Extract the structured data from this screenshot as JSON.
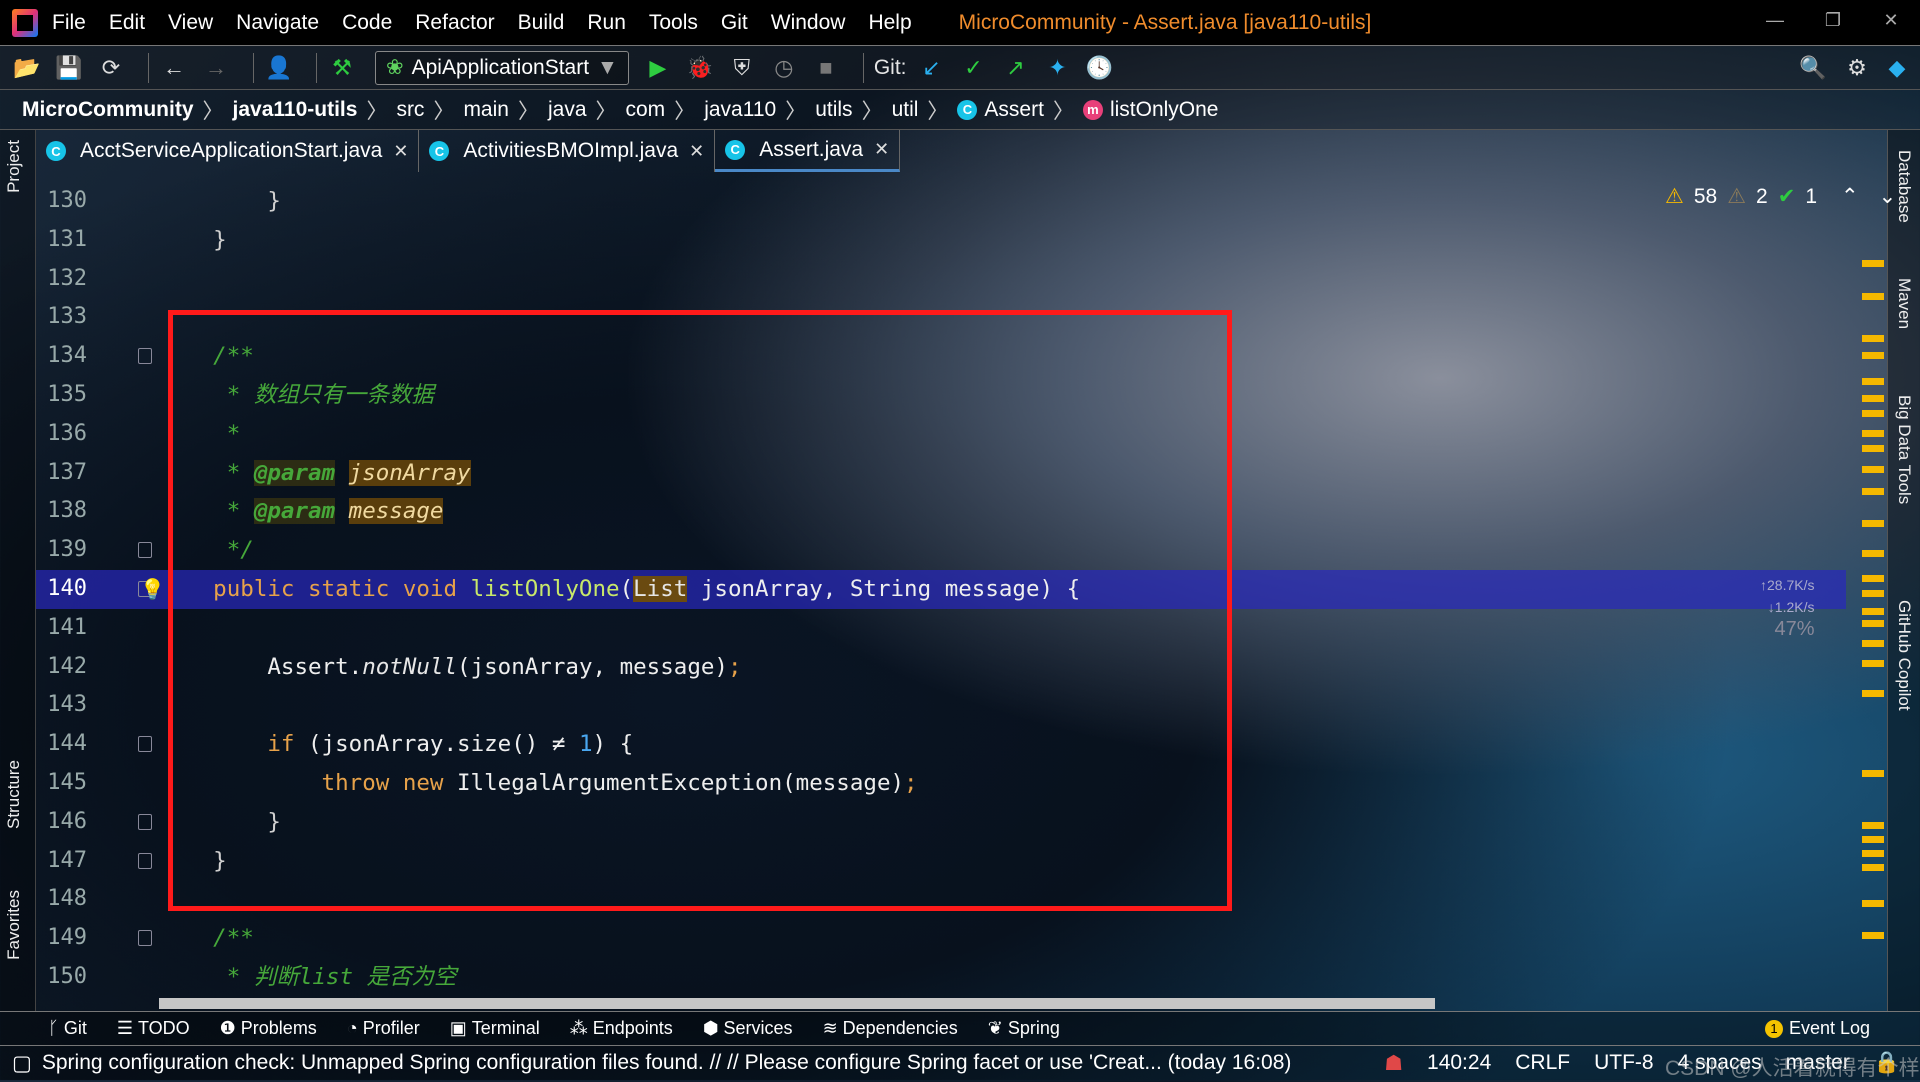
{
  "window": {
    "title": "MicroCommunity - Assert.java [java110-utils]",
    "controls": [
      "—",
      "❐",
      "✕"
    ]
  },
  "menu": [
    "File",
    "Edit",
    "View",
    "Navigate",
    "Code",
    "Refactor",
    "Build",
    "Run",
    "Tools",
    "Git",
    "Window",
    "Help"
  ],
  "toolbar": {
    "run_config": "ApiApplicationStart",
    "git_label": "Git:"
  },
  "breadcrumb": [
    "MicroCommunity",
    "java110-utils",
    "src",
    "main",
    "java",
    "com",
    "java110",
    "utils",
    "util",
    "Assert",
    "listOnlyOne"
  ],
  "tabs": [
    {
      "label": "AcctServiceApplicationStart.java"
    },
    {
      "label": "ActivitiesBMOImpl.java"
    },
    {
      "label": "Assert.java",
      "active": true
    }
  ],
  "left_tools": {
    "project": "Project",
    "structure": "Structure",
    "favorites": "Favorites"
  },
  "right_tools": {
    "database": "Database",
    "maven": "Maven",
    "bigdata": "Big Data Tools",
    "copilot": "GitHub Copilot"
  },
  "inspections": {
    "warnings": "58",
    "weak_warnings": "2",
    "typos": "1"
  },
  "network": {
    "up": "↑28.7K/s",
    "down": "↓1.2K/s",
    "percent": "47%"
  },
  "editor": {
    "current_line": 140,
    "lines": [
      {
        "n": 130,
        "tokens": [
          {
            "t": "        }",
            "c": "br"
          }
        ]
      },
      {
        "n": 131,
        "tokens": [
          {
            "t": "    }",
            "c": "br"
          }
        ]
      },
      {
        "n": 132,
        "tokens": []
      },
      {
        "n": 133,
        "tokens": []
      },
      {
        "n": 134,
        "fold": true,
        "tokens": [
          {
            "t": "    /**",
            "c": "cm"
          }
        ]
      },
      {
        "n": 135,
        "tokens": [
          {
            "t": "     * 数组只有一条数据",
            "c": "cm"
          }
        ]
      },
      {
        "n": 136,
        "tokens": [
          {
            "t": "     *",
            "c": "cm"
          }
        ]
      },
      {
        "n": 137,
        "tokens": [
          {
            "t": "     * ",
            "c": "cm"
          },
          {
            "t": "@param",
            "c": "tag"
          },
          {
            "t": " ",
            "c": "cm"
          },
          {
            "t": "jsonArray",
            "c": "pv"
          }
        ]
      },
      {
        "n": 138,
        "tokens": [
          {
            "t": "     * ",
            "c": "cm"
          },
          {
            "t": "@param",
            "c": "tag"
          },
          {
            "t": " ",
            "c": "cm"
          },
          {
            "t": "message",
            "c": "pv"
          }
        ]
      },
      {
        "n": 139,
        "fold": true,
        "tokens": [
          {
            "t": "     */",
            "c": "cm"
          }
        ]
      },
      {
        "n": 140,
        "fold": true,
        "tokens": [
          {
            "t": "    public static void ",
            "c": "k"
          },
          {
            "t": "listOnlyOne",
            "c": "fn"
          },
          {
            "t": "(",
            "c": "pl"
          },
          {
            "t": "List",
            "c": "ty"
          },
          {
            "t": " jsonArray, String message) {",
            "c": "pl"
          }
        ]
      },
      {
        "n": 141,
        "tokens": []
      },
      {
        "n": 142,
        "tokens": [
          {
            "t": "        Assert.",
            "c": "pl"
          },
          {
            "t": "notNull",
            "c": "it"
          },
          {
            "t": "(jsonArray, message)",
            "c": "pl"
          },
          {
            "t": ";",
            "c": "k"
          }
        ]
      },
      {
        "n": 143,
        "tokens": []
      },
      {
        "n": 144,
        "fold": true,
        "tokens": [
          {
            "t": "        if ",
            "c": "k"
          },
          {
            "t": "(jsonArray.size() ≠ ",
            "c": "pl"
          },
          {
            "t": "1",
            "c": "num"
          },
          {
            "t": ") {",
            "c": "pl"
          }
        ]
      },
      {
        "n": 145,
        "tokens": [
          {
            "t": "            throw new ",
            "c": "k"
          },
          {
            "t": "IllegalArgumentException(message)",
            "c": "pl"
          },
          {
            "t": ";",
            "c": "k"
          }
        ]
      },
      {
        "n": 146,
        "fold": true,
        "tokens": [
          {
            "t": "        }",
            "c": "br"
          }
        ]
      },
      {
        "n": 147,
        "fold": true,
        "tokens": [
          {
            "t": "    }",
            "c": "br"
          }
        ]
      },
      {
        "n": 148,
        "tokens": []
      },
      {
        "n": 149,
        "fold": true,
        "tokens": [
          {
            "t": "    /**",
            "c": "cm"
          }
        ]
      },
      {
        "n": 150,
        "tokens": [
          {
            "t": "     * 判断list 是否为空",
            "c": "cm"
          }
        ]
      }
    ]
  },
  "tool_windows": [
    "Git",
    "TODO",
    "Problems",
    "Profiler",
    "Terminal",
    "Endpoints",
    "Services",
    "Dependencies",
    "Spring"
  ],
  "event_log": {
    "label": "Event Log",
    "count": "1"
  },
  "status": {
    "message": "Spring configuration check: Unmapped Spring configuration files found. // // Please configure Spring facet or use 'Creat... (today 16:08)",
    "position": "140:24",
    "line_sep": "CRLF",
    "encoding": "UTF-8",
    "indent": "4 spaces",
    "branch": "master",
    "watermark": "CSDN @人活着就得有个样"
  },
  "colors": {
    "highlight_box": "#ff1a1a",
    "current_line": "#2828be",
    "keyword": "#e7a24a",
    "comment": "#46a83a"
  }
}
